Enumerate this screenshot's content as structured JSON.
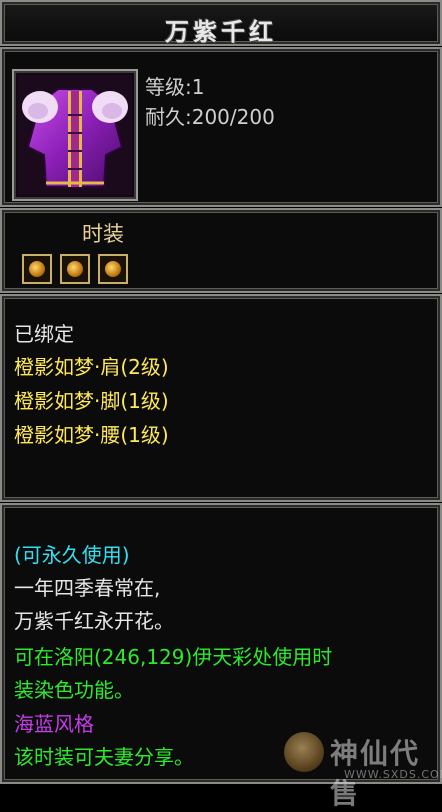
{
  "item": {
    "name": "万紫千红",
    "level": "等级:1",
    "durability": "耐久:200/200",
    "category": "时装",
    "socket_count": 3
  },
  "attributes": {
    "bound": "已绑定",
    "sets": [
      "橙影如梦·肩(2级)",
      "橙影如梦·脚(1级)",
      "橙影如梦·腰(1级)"
    ]
  },
  "description": {
    "usage": "(可永久使用)",
    "poem_line1": "一年四季春常在,",
    "poem_line2": "万紫千红永开花。",
    "dye_line1": "可在洛阳(246,129)伊天彩处使用时",
    "dye_line2": "装染色功能。",
    "style": "海蓝风格",
    "share": "该时装可夫妻分享。"
  },
  "watermark": {
    "text": "神仙代售",
    "url": "WWW.SXDS.COM"
  },
  "colors": {
    "bound": "#e6e6e6",
    "set": "#ffe95a",
    "usage": "#33e0f0",
    "dye": "#2ee82e",
    "style": "#c63ce8",
    "share": "#2ee82e"
  }
}
